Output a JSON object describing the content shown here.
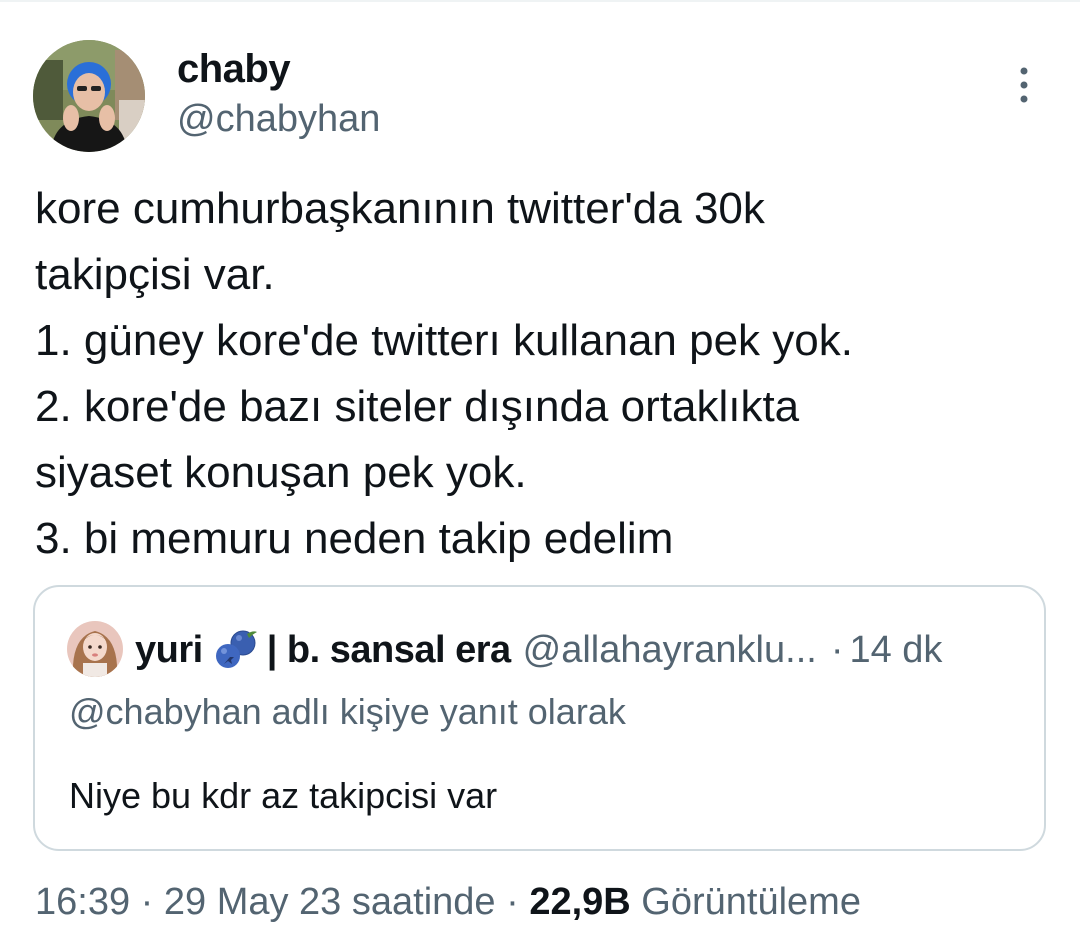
{
  "tweet": {
    "author": {
      "display_name": "chaby",
      "handle": "@chabyhan",
      "avatar_icon": "profile-photo"
    },
    "more_icon": "more-vertical-icon",
    "text_lines": [
      "kore cumhurbaşkanının twitter'da 30k",
      "takipçisi var.",
      "1. güney kore'de twitterı kullanan pek yok.",
      "2. kore'de bazı siteler dışında ortaklıkta",
      "siyaset konuşan pek yok.",
      "3. bi memuru neden takip edelim"
    ],
    "quote": {
      "author_name": "yuri",
      "name_emoji": "blueberries-icon",
      "author_name_tail": "| b. sansal era",
      "handle": "@allahayranklu...",
      "separator": "·",
      "time": "14 dk",
      "reply_to": "@chabyhan adlı kişiye yanıt olarak",
      "text": "Niye bu kdr az takipcisi var"
    },
    "meta": {
      "time": "16:39",
      "sep1": "·",
      "date": "29 May 23 saatinde",
      "sep2": "·",
      "views_count": "22,9B",
      "views_label": "Görüntüleme"
    }
  },
  "colors": {
    "text_primary": "#0f1419",
    "text_secondary": "#536471",
    "border": "#cfd9de"
  }
}
